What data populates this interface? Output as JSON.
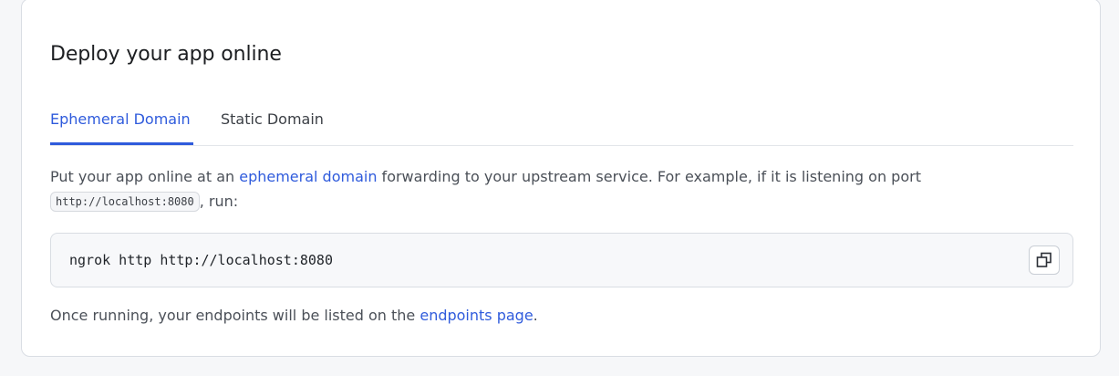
{
  "title": "Deploy your app online",
  "tabs": [
    {
      "label": "Ephemeral Domain",
      "active": true
    },
    {
      "label": "Static Domain",
      "active": false
    }
  ],
  "description": {
    "part1": "Put your app online at an ",
    "link": "ephemeral domain",
    "part2": " forwarding to your upstream service. For example, if it is listening on port ",
    "code": "http://localhost:8080",
    "part3": ", run:"
  },
  "command": "ngrok http http://localhost:8080",
  "copy_icon": "copy-icon",
  "footer": {
    "part1": "Once running, your endpoints will be listed on the ",
    "link": "endpoints page",
    "part2": "."
  },
  "colors": {
    "accent": "#2f5bdc",
    "text": "#4b5058",
    "border": "#d9dde3"
  }
}
